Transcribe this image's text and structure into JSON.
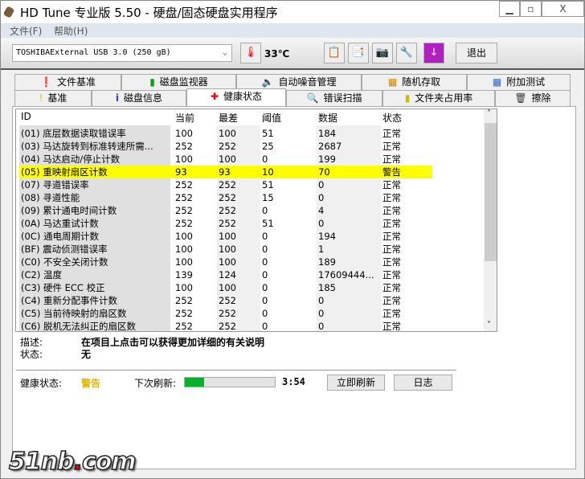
{
  "window": {
    "title": "HD Tune 专业版 5.50 - 硬盘/固态硬盘实用程序",
    "minimize": "▁",
    "maximize": "▫",
    "close": "X"
  },
  "menu": [
    "文件(F)",
    "帮助(H)"
  ],
  "toolbar": {
    "drive": "TOSHIBAExternal USB 3.0 (250 gB)",
    "temperature": "33℃",
    "exit": "退出"
  },
  "tabs_row1": [
    "文件基准",
    "磁盘监视器",
    "自动噪音管理",
    "随机存取",
    "附加测试"
  ],
  "tabs_row2": [
    "基准",
    "磁盘信息",
    "健康状态",
    "错误扫描",
    "文件夹占用率",
    "擦除"
  ],
  "active_tab": "健康状态",
  "table": {
    "headers": [
      "ID",
      "当前",
      "最差",
      "阈值",
      "数据",
      "状态"
    ],
    "rows": [
      [
        "(01) 底层数据读取错误率",
        "100",
        "100",
        "51",
        "184",
        "正常"
      ],
      [
        "(03) 马达旋转到标准转速所需...",
        "252",
        "252",
        "25",
        "2687",
        "正常"
      ],
      [
        "(04) 马达启动/停止计数",
        "100",
        "100",
        "0",
        "199",
        "正常"
      ],
      [
        "(05) 重映射扇区计数",
        "93",
        "93",
        "10",
        "70",
        "警告"
      ],
      [
        "(07) 寻道错误率",
        "252",
        "252",
        "51",
        "0",
        "正常"
      ],
      [
        "(08) 寻道性能",
        "252",
        "252",
        "15",
        "0",
        "正常"
      ],
      [
        "(09) 累计通电时间计数",
        "252",
        "252",
        "0",
        "4",
        "正常"
      ],
      [
        "(0A) 马达重试计数",
        "252",
        "252",
        "51",
        "0",
        "正常"
      ],
      [
        "(0C) 通电周期计数",
        "100",
        "100",
        "0",
        "194",
        "正常"
      ],
      [
        "(BF) 震动侦测错误率",
        "100",
        "100",
        "0",
        "1",
        "正常"
      ],
      [
        "(C0) 不安全关闭计数",
        "100",
        "100",
        "0",
        "189",
        "正常"
      ],
      [
        "(C2) 温度",
        "139",
        "124",
        "0",
        "17609444...",
        "正常"
      ],
      [
        "(C3) 硬件 ECC 校正",
        "100",
        "100",
        "0",
        "185",
        "正常"
      ],
      [
        "(C4) 重新分配事件计数",
        "252",
        "252",
        "0",
        "0",
        "正常"
      ],
      [
        "(C5) 当前待映射的扇区数",
        "252",
        "252",
        "0",
        "0",
        "正常"
      ],
      [
        "(C6) 脱机无法纠正的扇区数",
        "252",
        "252",
        "0",
        "0",
        "正常"
      ]
    ],
    "warning_row_color": "#ffff00"
  },
  "details": {
    "desc_label": "描述:",
    "desc_value": "在项目上点击可以获得更加详细的有关说明",
    "status_label": "状态:",
    "status_value": "无"
  },
  "footer": {
    "health_label": "健康状态:",
    "health_value": "警告",
    "health_color": "#e8b400",
    "refresh_label": "下次刷新:",
    "refresh_progress_percent": 21,
    "countdown": "3:54",
    "refresh_now": "立即刷新",
    "log": "日志"
  },
  "watermark": "51nb.com"
}
